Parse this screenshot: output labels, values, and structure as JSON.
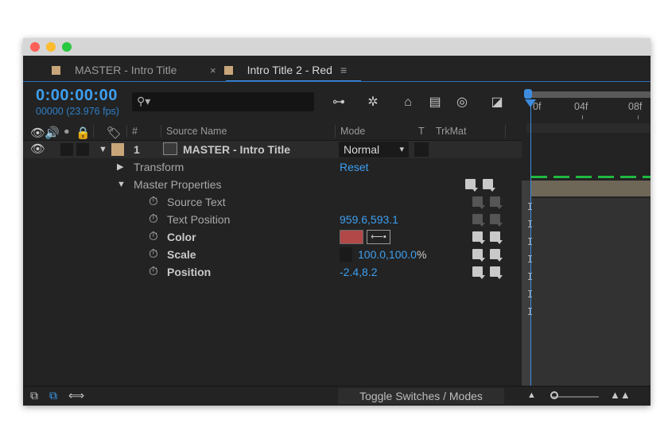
{
  "window": {
    "tabs": [
      {
        "label": "MASTER - Intro Title",
        "active": false
      },
      {
        "label": "Intro Title 2 - Red",
        "active": true,
        "close": "×",
        "menu": "≡"
      }
    ]
  },
  "composition": {
    "timecode": "0:00:00:00",
    "fps_line": "00000 (23.976 fps)"
  },
  "search": {
    "icon": "search-icon",
    "glyph": "⚲▾"
  },
  "toolbar": {
    "icons": [
      "layer-switch-icon",
      "shy-layers-icon",
      "frame-blending-icon",
      "motion-blur-icon",
      "graph-editor-icon",
      "snap-icon"
    ]
  },
  "columns": {
    "hash": "#",
    "source_name": "Source Name",
    "mode": "Mode",
    "t": "T",
    "trkmat": "TrkMat"
  },
  "layer": {
    "number": "1",
    "name": "MASTER - Intro Title",
    "mode": "Normal",
    "label_color": "#c8a67a"
  },
  "properties": {
    "transform": {
      "label": "Transform",
      "value": "Reset"
    },
    "master_properties": {
      "label": "Master Properties"
    },
    "source_text": {
      "label": "Source Text"
    },
    "text_position": {
      "label": "Text Position",
      "value": "959.6,593.1"
    },
    "color": {
      "label": "Color",
      "swatch": "#b34848"
    },
    "scale": {
      "label": "Scale",
      "value": "100.0,100.0",
      "unit": "%"
    },
    "position": {
      "label": "Position",
      "value": "-2.4,8.2"
    }
  },
  "timeline": {
    "ticks": [
      "0f",
      "04f",
      "08f"
    ],
    "playhead_accent": "#3d8ce0",
    "workarea_color": "#1fb93f"
  },
  "bottom": {
    "toggle_label": "Toggle Switches / Modes"
  },
  "colors": {
    "accent": "#3d9ff0",
    "panel_bg": "#232323",
    "layer_bar": "#6e6657"
  }
}
